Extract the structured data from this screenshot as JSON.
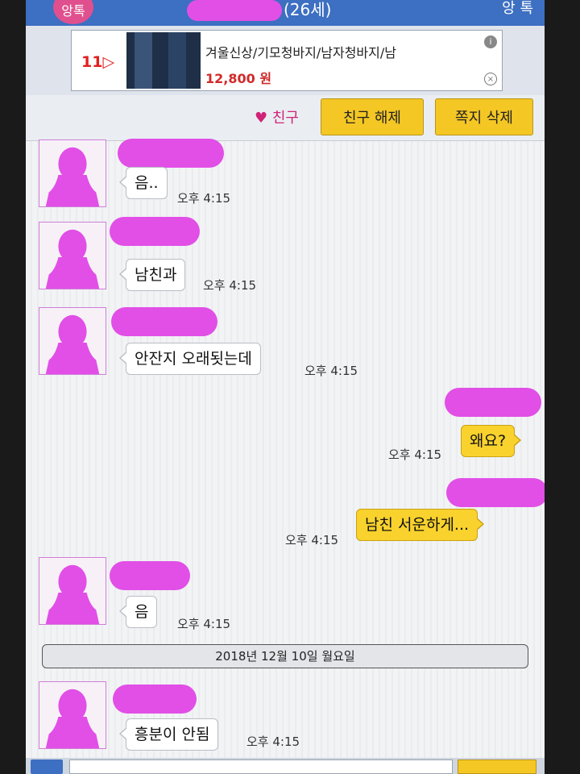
{
  "header": {
    "app_logo_text": "앙톡",
    "title_suffix": "(26세)",
    "action_label": "앙 톡"
  },
  "ad": {
    "brand": "11▷",
    "title": "겨울신상/기모청바지/남자청바지/남",
    "price": "12,800 원",
    "info_icon": "i",
    "close_icon": "×"
  },
  "actions": {
    "friend_label": "♥ 친구",
    "unfriend_label": "친구 해제",
    "delete_label": "쪽지 삭제"
  },
  "messages": [
    {
      "text": "음..",
      "time": "오후 4:15",
      "outgoing": false
    },
    {
      "text": "남친과",
      "time": "오후 4:15",
      "outgoing": false
    },
    {
      "text": "안잔지 오래됫는데",
      "time": "오후 4:15",
      "outgoing": false
    },
    {
      "text": "왜요?",
      "time": "오후 4:15",
      "outgoing": true
    },
    {
      "text": "남친 서운하게...",
      "time": "오후 4:15",
      "outgoing": true
    },
    {
      "text": "음",
      "time": "오후 4:15",
      "outgoing": false
    },
    {
      "text": "흥분이 안됨",
      "time": "오후 4:15",
      "outgoing": false
    }
  ],
  "date_divider": "2018년 12월 10일 월요일",
  "colors": {
    "header_blue": "#3d6fc2",
    "outgoing_bubble": "#f9d22d",
    "redaction": "#e14fe6",
    "avatar": "#e14fe6"
  }
}
